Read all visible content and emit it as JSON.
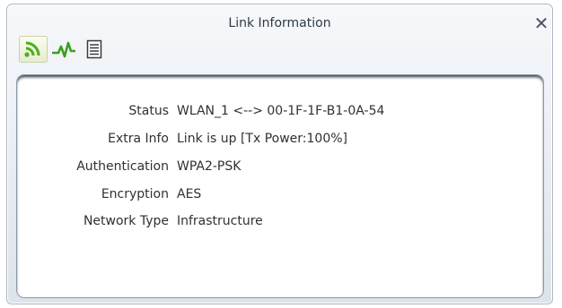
{
  "window": {
    "title": "Link Information",
    "close_label": "✕"
  },
  "toolbar": {
    "buttons": [
      {
        "icon": "signal-icon",
        "selected": true
      },
      {
        "icon": "activity-icon",
        "selected": false
      },
      {
        "icon": "document-icon",
        "selected": false
      }
    ]
  },
  "info": {
    "rows": [
      {
        "label": "Status",
        "value": "WLAN_1 <--> 00-1F-1F-B1-0A-54"
      },
      {
        "label": "Extra Info",
        "value": "Link is up  [Tx Power:100%]"
      },
      {
        "label": "Authentication",
        "value": "WPA2-PSK"
      },
      {
        "label": "Encryption",
        "value": "AES"
      },
      {
        "label": "Network Type",
        "value": "Infrastructure"
      }
    ]
  },
  "colors": {
    "accent_green": "#4caf1a",
    "panel_border": "#8d99a8"
  }
}
